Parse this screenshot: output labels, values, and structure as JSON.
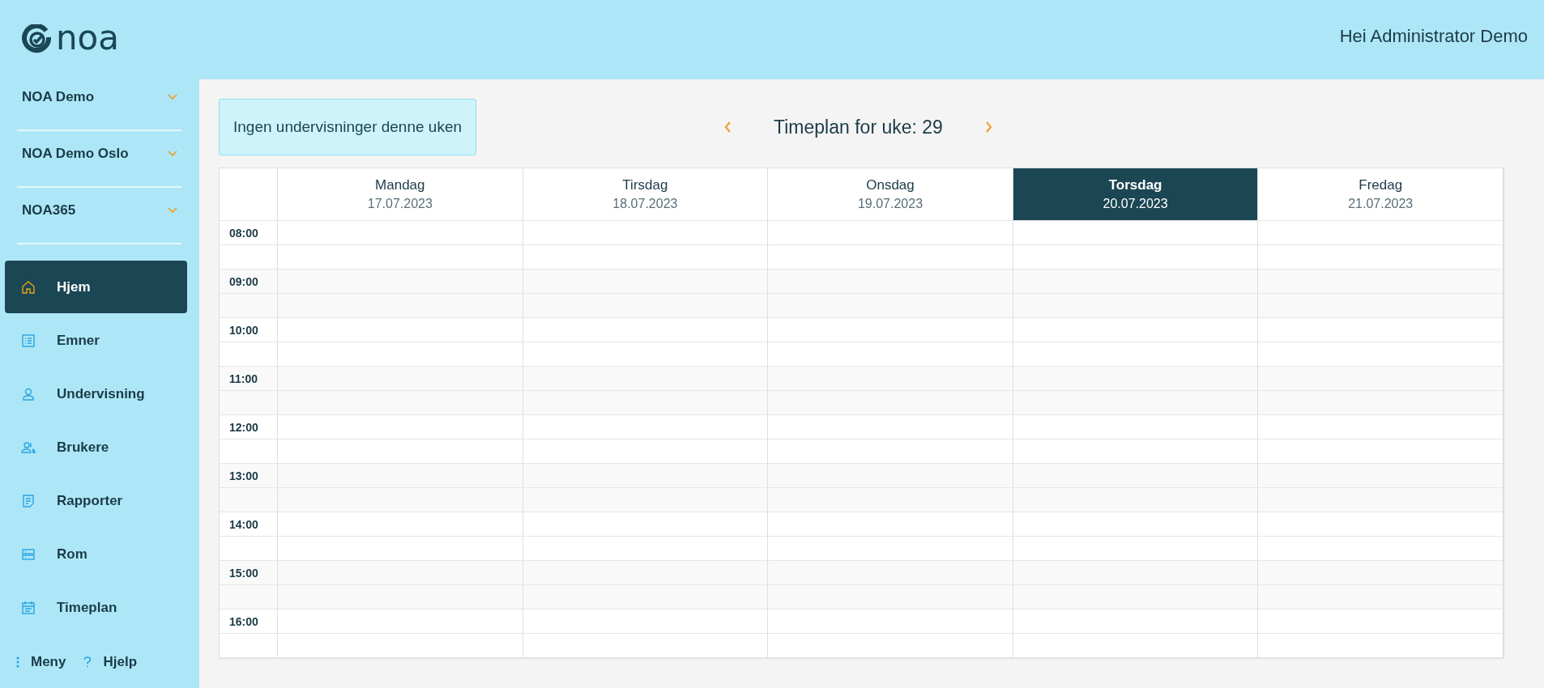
{
  "logo": {
    "text": "noa"
  },
  "greeting": "Hei Administrator Demo",
  "organizations": [
    {
      "label": "NOA Demo",
      "expanded": false
    },
    {
      "label": "NOA Demo Oslo",
      "expanded": false
    },
    {
      "label": "NOA365",
      "expanded": false
    }
  ],
  "nav": [
    {
      "label": "Hjem",
      "selected": true
    },
    {
      "label": "Emner",
      "selected": false
    },
    {
      "label": "Undervisning",
      "selected": false
    },
    {
      "label": "Brukere",
      "selected": false
    },
    {
      "label": "Rapporter",
      "selected": false
    },
    {
      "label": "Rom",
      "selected": false
    },
    {
      "label": "Timeplan",
      "selected": false
    }
  ],
  "footer": {
    "menu": "Meny",
    "help": "Hjelp"
  },
  "notice": "Ingen undervisninger denne uken",
  "week_title": "Timeplan for uke: 29",
  "days": [
    {
      "name": "Mandag",
      "date": "17.07.2023",
      "selected": false
    },
    {
      "name": "Tirsdag",
      "date": "18.07.2023",
      "selected": false
    },
    {
      "name": "Onsdag",
      "date": "19.07.2023",
      "selected": false
    },
    {
      "name": "Torsdag",
      "date": "20.07.2023",
      "selected": true
    },
    {
      "name": "Fredag",
      "date": "21.07.2023",
      "selected": false
    }
  ],
  "hours": [
    "08:00",
    "09:00",
    "10:00",
    "11:00",
    "12:00",
    "13:00",
    "14:00",
    "15:00",
    "16:00"
  ]
}
